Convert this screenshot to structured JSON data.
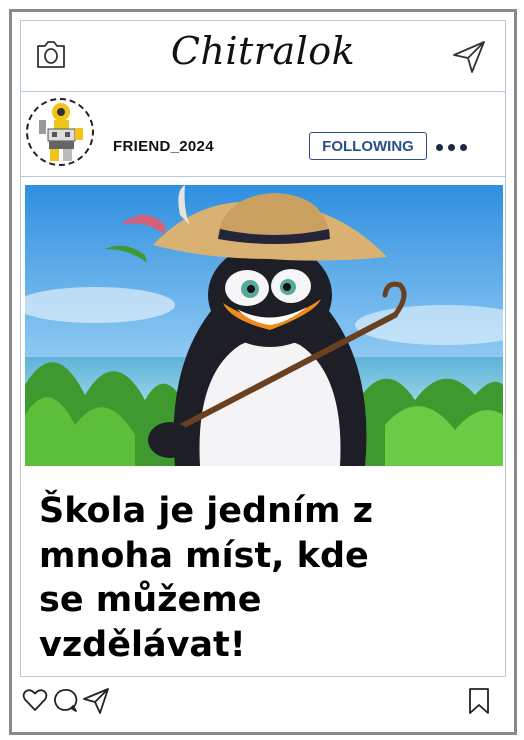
{
  "app": {
    "title": "Chitralok"
  },
  "icons": {
    "camera": "camera-icon",
    "send": "send-icon",
    "more": "more-options-icon",
    "like": "heart-icon",
    "comment": "comment-icon",
    "share": "share-icon",
    "save": "bookmark-icon"
  },
  "post": {
    "username": "FRIEND_2024",
    "follow_label": "FOLLOWING",
    "caption_lines": [
      "Škola je jedním z",
      "mnoha míst, kde",
      "se můžeme",
      "vzdělávat!"
    ]
  },
  "colors": {
    "accent": "#2b4f8a",
    "frame": "#8a8a8a",
    "divider": "#b9c8d8"
  }
}
